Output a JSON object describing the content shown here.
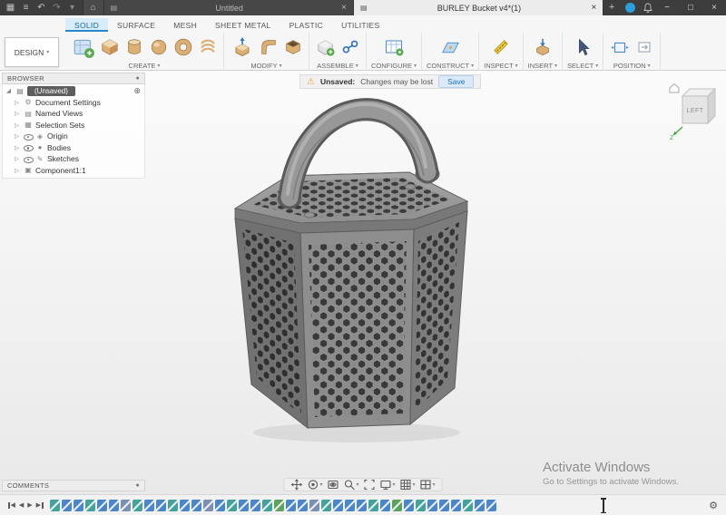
{
  "icons": {
    "menu": "≡",
    "app_grid": "▦",
    "undo": "↶",
    "redo": "↷",
    "home_tab": "⌂",
    "tab_doc": "▤",
    "close": "×",
    "minimize": "−",
    "maximize": "□",
    "new_tab": "+",
    "caret": "▾",
    "expander": "▷",
    "expander_open": "◢",
    "gear": "⚙",
    "header_dot": "●",
    "circle_plus": "⊕",
    "warning": "⚠",
    "tri_left": "◀",
    "tri_right": "▶"
  },
  "titlebar": {
    "tabs": [
      {
        "label": "Untitled"
      },
      {
        "label": "BURLEY Bucket v4*(1)"
      }
    ]
  },
  "ribbon": {
    "workspace": "DESIGN",
    "tabs": [
      "SOLID",
      "SURFACE",
      "MESH",
      "SHEET METAL",
      "PLASTIC",
      "UTILITIES"
    ],
    "groups": [
      "CREATE",
      "MODIFY",
      "ASSEMBLE",
      "CONFIGURE",
      "CONSTRUCT",
      "INSPECT",
      "INSERT",
      "SELECT",
      "POSITION"
    ]
  },
  "warning": {
    "label": "Unsaved:",
    "message": "Changes may be lost",
    "action": "Save"
  },
  "browser": {
    "title": "BROWSER",
    "root_label": "(Unsaved)",
    "items": [
      {
        "label": "Document Settings",
        "glyph": "⚙",
        "eye": false
      },
      {
        "label": "Named Views",
        "glyph": "▤",
        "eye": false
      },
      {
        "label": "Selection Sets",
        "glyph": "▦",
        "eye": false
      },
      {
        "label": "Origin",
        "glyph": "◈",
        "eye": true
      },
      {
        "label": "Bodies",
        "glyph": "●",
        "eye": true
      },
      {
        "label": "Sketches",
        "glyph": "✎",
        "eye": true
      },
      {
        "label": "Component1:1",
        "glyph": "▣",
        "eye": false
      }
    ]
  },
  "viewcube": {
    "face": "LEFT",
    "axis_z": "Z"
  },
  "comments": {
    "title": "COMMENTS"
  },
  "watermark": {
    "line1": "Activate Windows",
    "line2": "Go to Settings to activate Windows."
  },
  "timeline": {
    "markers": [
      "s",
      "f",
      "f",
      "s",
      "f",
      "f",
      "m",
      "s",
      "f",
      "f",
      "s",
      "f",
      "f",
      "m",
      "f",
      "s",
      "f",
      "f",
      "s",
      "c",
      "f",
      "f",
      "m",
      "s",
      "f",
      "f",
      "f",
      "s",
      "f",
      "c",
      "f",
      "s",
      "f",
      "f",
      "f",
      "s",
      "f",
      "f"
    ]
  }
}
